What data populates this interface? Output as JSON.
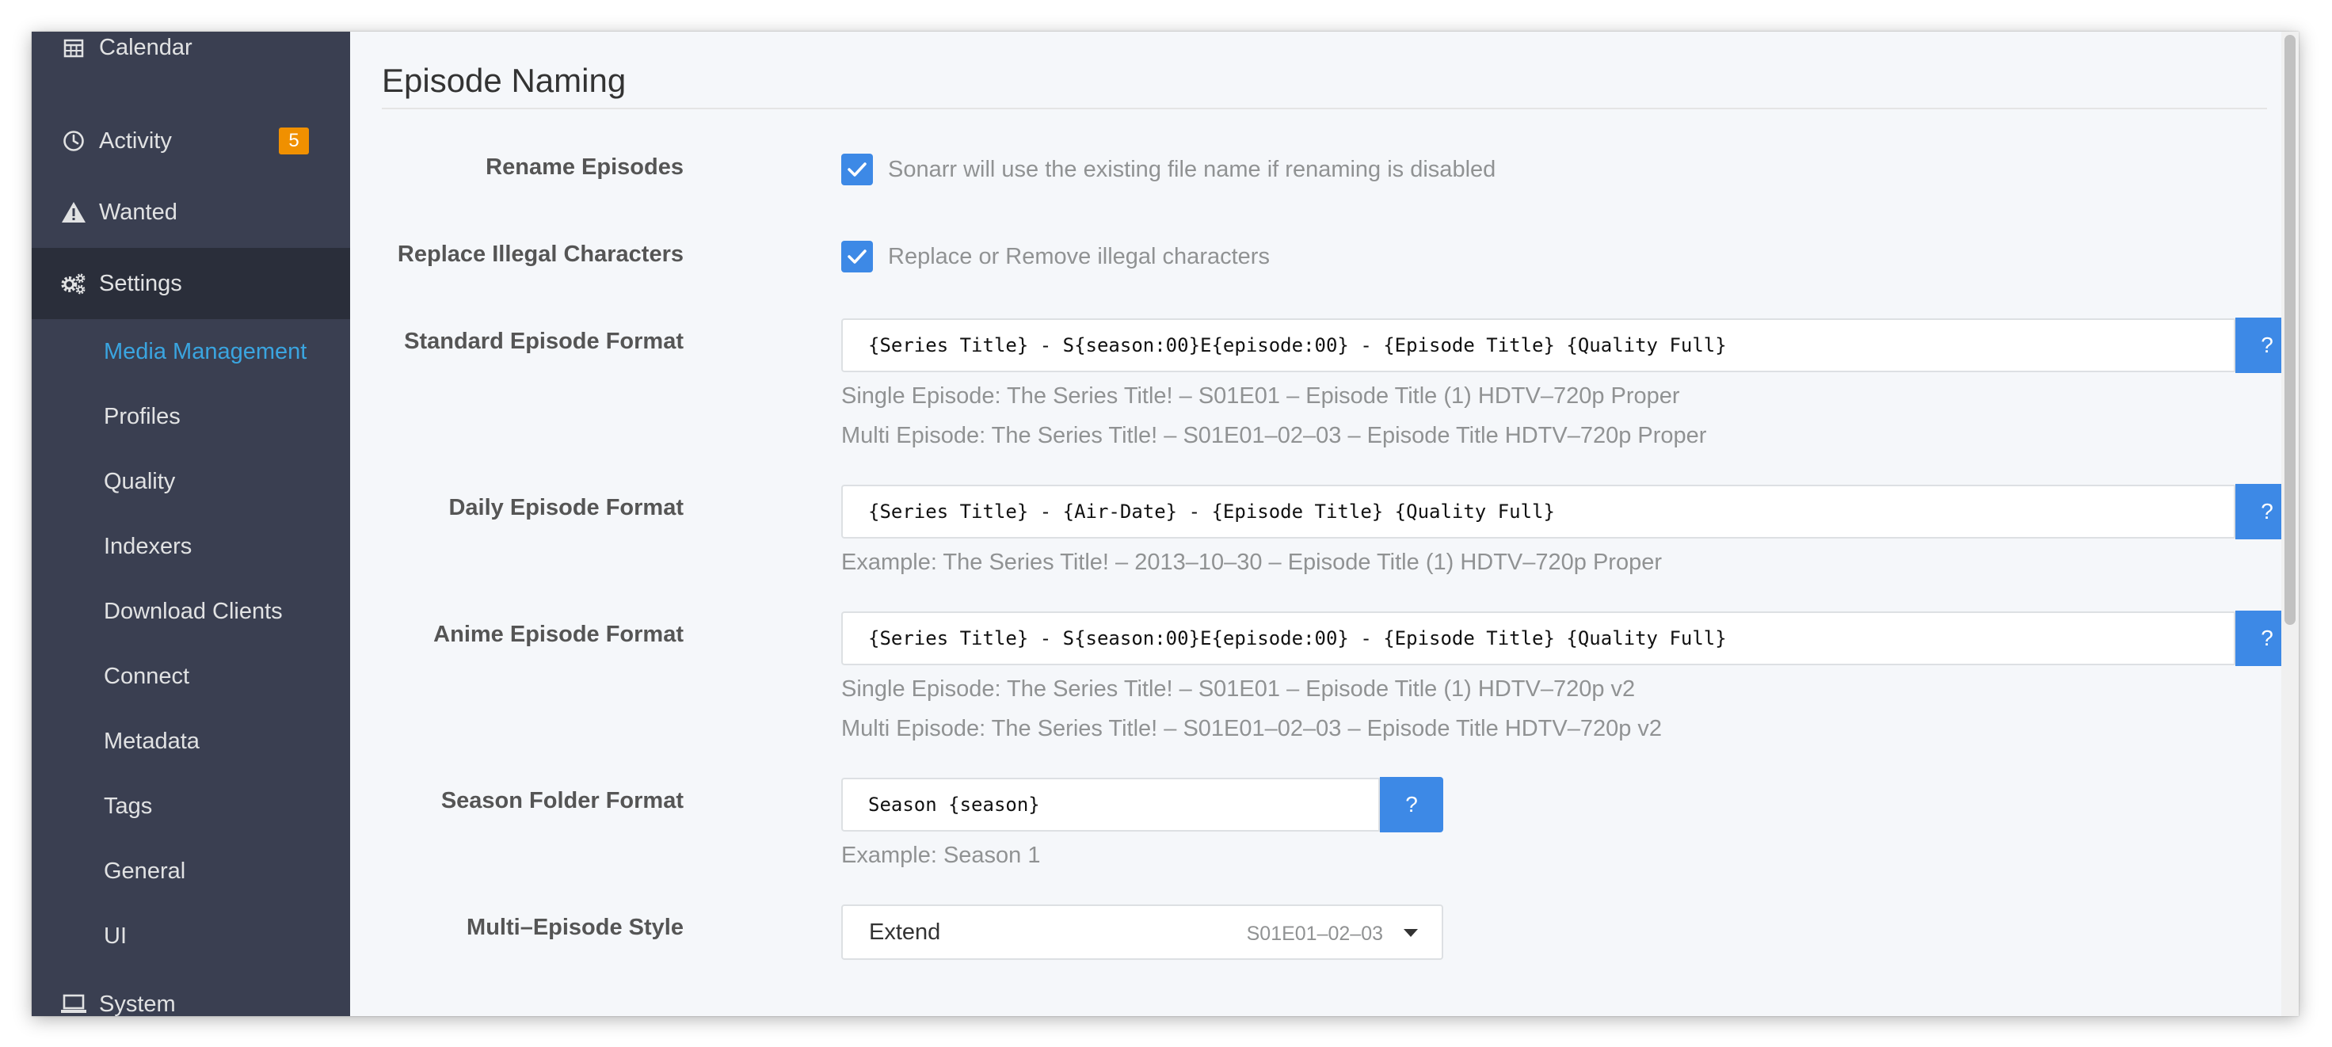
{
  "sidebar": {
    "items": [
      {
        "label": "Calendar",
        "icon": "calendar-icon"
      },
      {
        "label": "Activity",
        "icon": "clock-icon",
        "badge": "5"
      },
      {
        "label": "Wanted",
        "icon": "warning-icon"
      },
      {
        "label": "Settings",
        "icon": "gears-icon"
      },
      {
        "label": "System",
        "icon": "laptop-icon"
      }
    ],
    "settings_sub": [
      {
        "label": "Media Management"
      },
      {
        "label": "Profiles"
      },
      {
        "label": "Quality"
      },
      {
        "label": "Indexers"
      },
      {
        "label": "Download Clients"
      },
      {
        "label": "Connect"
      },
      {
        "label": "Metadata"
      },
      {
        "label": "Tags"
      },
      {
        "label": "General"
      },
      {
        "label": "UI"
      }
    ]
  },
  "section": {
    "title": "Episode Naming"
  },
  "fields": {
    "rename_episodes": {
      "label": "Rename Episodes",
      "checked": true,
      "help": "Sonarr will use the existing file name if renaming is disabled"
    },
    "replace_illegal": {
      "label": "Replace Illegal Characters",
      "checked": true,
      "help": "Replace or Remove illegal characters"
    },
    "standard_format": {
      "label": "Standard Episode Format",
      "value": "{Series Title} - S{season:00}E{episode:00} - {Episode Title} {Quality Full}",
      "button": "?",
      "example_single": "Single Episode: The Series Title! – S01E01 – Episode Title (1) HDTV–720p Proper",
      "example_multi": "Multi Episode: The Series Title! – S01E01–02–03 – Episode Title HDTV–720p Proper"
    },
    "daily_format": {
      "label": "Daily Episode Format",
      "value": "{Series Title} - {Air-Date} - {Episode Title} {Quality Full}",
      "button": "?",
      "example": "Example: The Series Title! – 2013–10–30 – Episode Title (1) HDTV–720p Proper"
    },
    "anime_format": {
      "label": "Anime Episode Format",
      "value": "{Series Title} - S{season:00}E{episode:00} - {Episode Title} {Quality Full}",
      "button": "?",
      "example_single": "Single Episode: The Series Title! – S01E01 – Episode Title (1) HDTV–720p v2",
      "example_multi": "Multi Episode: The Series Title! – S01E01–02–03 – Episode Title HDTV–720p v2"
    },
    "season_folder": {
      "label": "Season Folder Format",
      "value": "Season {season}",
      "button": "?",
      "example": "Example: Season 1"
    },
    "multi_episode_style": {
      "label": "Multi–Episode Style",
      "selected": "Extend",
      "hint": "S01E01–02–03"
    }
  },
  "colors": {
    "sidebar_bg": "#3a3f51",
    "sidebar_active_bg": "#2a2e3a",
    "accent_blue": "#3d89e6",
    "active_link": "#3aa5e0",
    "badge": "#f09000"
  }
}
